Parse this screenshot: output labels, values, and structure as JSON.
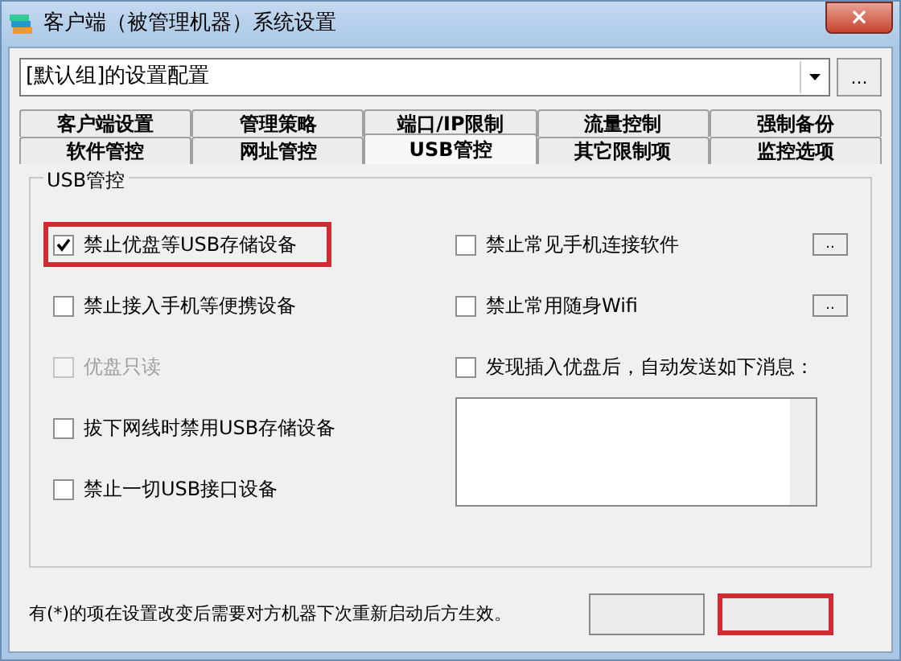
{
  "window": {
    "title": "客户端（被管理机器）系统设置",
    "close": "×"
  },
  "config": {
    "value": "[默认组]的设置配置",
    "more": "..."
  },
  "tab_rows": [
    [
      {
        "label": "客户端设置",
        "selected": false
      },
      {
        "label": "管理策略",
        "selected": false
      },
      {
        "label": "端口/IP限制",
        "selected": false
      },
      {
        "label": "流量控制",
        "selected": false
      },
      {
        "label": "强制备份",
        "selected": false
      }
    ],
    [
      {
        "label": "软件管控",
        "selected": false
      },
      {
        "label": "网址管控",
        "selected": false
      },
      {
        "label": "USB管控",
        "selected": true
      },
      {
        "label": "其它限制项",
        "selected": false
      },
      {
        "label": "监控选项",
        "selected": false
      }
    ]
  ],
  "group": {
    "title": "USB管控",
    "left": [
      {
        "label": "禁止优盘等USB存储设备",
        "checked": true,
        "disabled": false,
        "highlighted": true
      },
      {
        "label": "禁止接入手机等便携设备",
        "checked": false,
        "disabled": false,
        "highlighted": false
      },
      {
        "label": "优盘只读",
        "checked": false,
        "disabled": true,
        "highlighted": false
      },
      {
        "label": "拔下网线时禁用USB存储设备",
        "checked": false,
        "disabled": false,
        "highlighted": false
      },
      {
        "label": "禁止一切USB接口设备",
        "checked": false,
        "disabled": false,
        "highlighted": false
      }
    ],
    "right": [
      {
        "label": "禁止常见手机连接软件",
        "checked": false,
        "disabled": false,
        "highlighted": false,
        "more": ".."
      },
      {
        "label": "禁止常用随身Wifi",
        "checked": false,
        "disabled": false,
        "highlighted": false,
        "more": ".."
      },
      {
        "label": "发现插入优盘后，自动发送如下消息：",
        "checked": false,
        "disabled": false,
        "highlighted": false
      }
    ]
  },
  "footer": {
    "note": "有(*)的项在设置改变后需要对方机器下次重新启动后方生效。",
    "buttons": [
      {
        "highlighted": false
      },
      {
        "highlighted": true
      }
    ]
  }
}
